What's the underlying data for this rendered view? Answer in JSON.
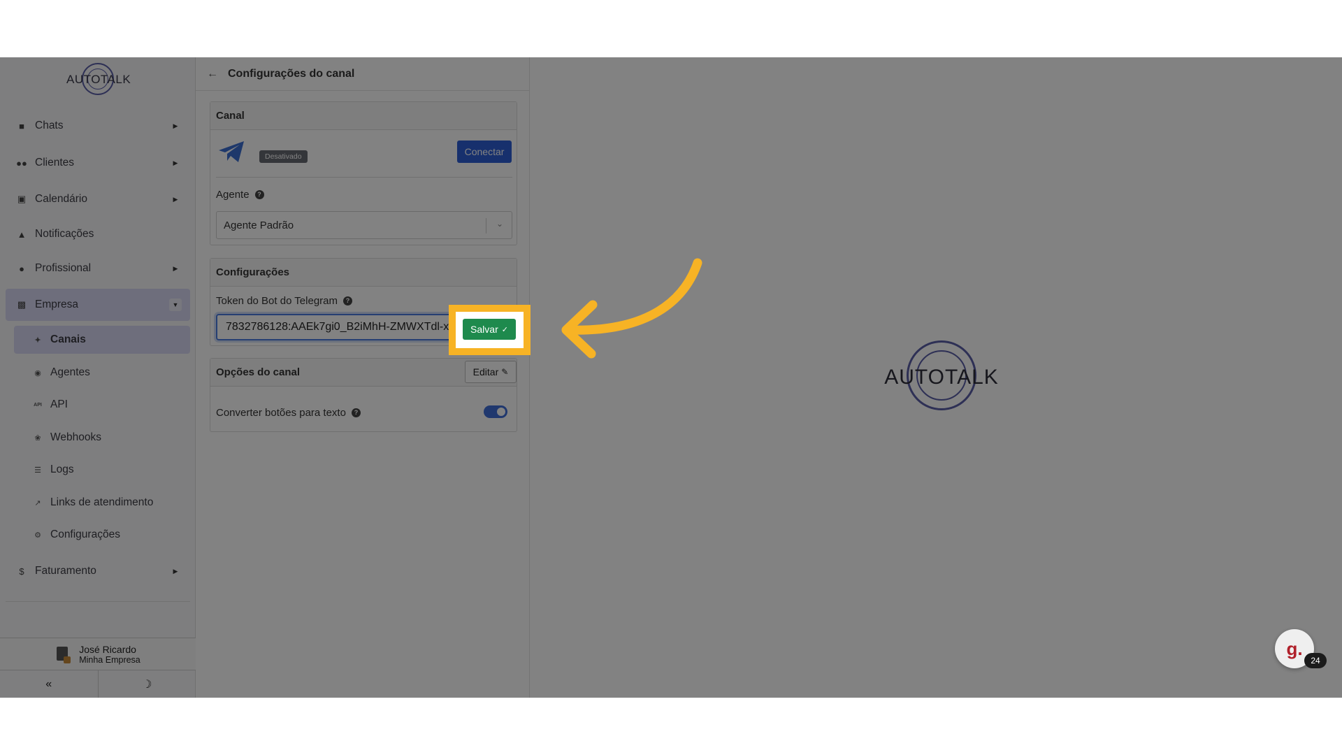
{
  "app": {
    "logo_text": "AUTOTALK"
  },
  "sidebar": {
    "items": [
      {
        "label": "Chats"
      },
      {
        "label": "Clientes"
      },
      {
        "label": "Calendário"
      },
      {
        "label": "Notificações"
      },
      {
        "label": "Profissional"
      },
      {
        "label": "Empresa"
      },
      {
        "label": "Faturamento"
      }
    ],
    "sub_items": [
      {
        "label": "Canais"
      },
      {
        "label": "Agentes"
      },
      {
        "label": "API"
      },
      {
        "label": "Webhooks"
      },
      {
        "label": "Logs"
      },
      {
        "label": "Links de atendimento"
      },
      {
        "label": "Configurações"
      }
    ],
    "api_icon_text": "API"
  },
  "user": {
    "name": "José Ricardo",
    "company": "Minha Empresa"
  },
  "panel": {
    "title": "Configurações do canal",
    "channel_card": {
      "title": "Canal",
      "status_badge": "Desativado",
      "connect_label": "Conectar",
      "agent_label": "Agente",
      "agent_value": "Agente Padrão"
    },
    "config_card": {
      "title": "Configurações",
      "save_label": "Salvar",
      "token_label": "Token do Bot do Telegram",
      "token_value": "7832786128:AAEk7gi0_B2iMhH-ZMWXTdl-xFrE1b8Y"
    },
    "options_card": {
      "title": "Opções do canal",
      "edit_label": "Editar",
      "convert_label": "Converter botões para texto",
      "convert_on": true
    }
  },
  "chat_widget": {
    "letter": "g.",
    "count": "24"
  },
  "colors": {
    "accent": "#2d5fd6",
    "save": "#1e8a4d",
    "highlight": "#f7b325",
    "active_nav": "#d8d8f4"
  }
}
